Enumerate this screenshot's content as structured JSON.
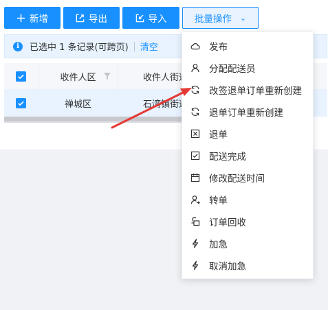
{
  "toolbar": {
    "add_label": "新增",
    "export_label": "导出",
    "import_label": "导入",
    "batch_label": "批量操作"
  },
  "alert": {
    "selection_text": "已选中 1 条记录(可跨页)",
    "clear_label": "清空"
  },
  "table": {
    "columns": [
      "收件人区",
      "收件人街道"
    ],
    "rows": [
      {
        "district": "禅城区",
        "street": "石湾镇街道"
      }
    ]
  },
  "menu": {
    "items": [
      {
        "label": "发布",
        "icon": "cloud-icon"
      },
      {
        "label": "分配配送员",
        "icon": "user-icon"
      },
      {
        "label": "改签退单订单重新创建",
        "icon": "refresh-icon"
      },
      {
        "label": "退单订单重新创建",
        "icon": "refresh-icon"
      },
      {
        "label": "退单",
        "icon": "close-box-icon"
      },
      {
        "label": "配送完成",
        "icon": "check-box-icon"
      },
      {
        "label": "修改配送时间",
        "icon": "calendar-icon"
      },
      {
        "label": "转单",
        "icon": "user-transfer-icon"
      },
      {
        "label": "订单回收",
        "icon": "recycle-icon"
      },
      {
        "label": "加急",
        "icon": "lightning-icon"
      },
      {
        "label": "取消加急",
        "icon": "lightning-icon"
      }
    ]
  },
  "colors": {
    "primary": "#1890ff",
    "selected_row": "#e8f3ff",
    "annotation_arrow": "#e53935"
  }
}
